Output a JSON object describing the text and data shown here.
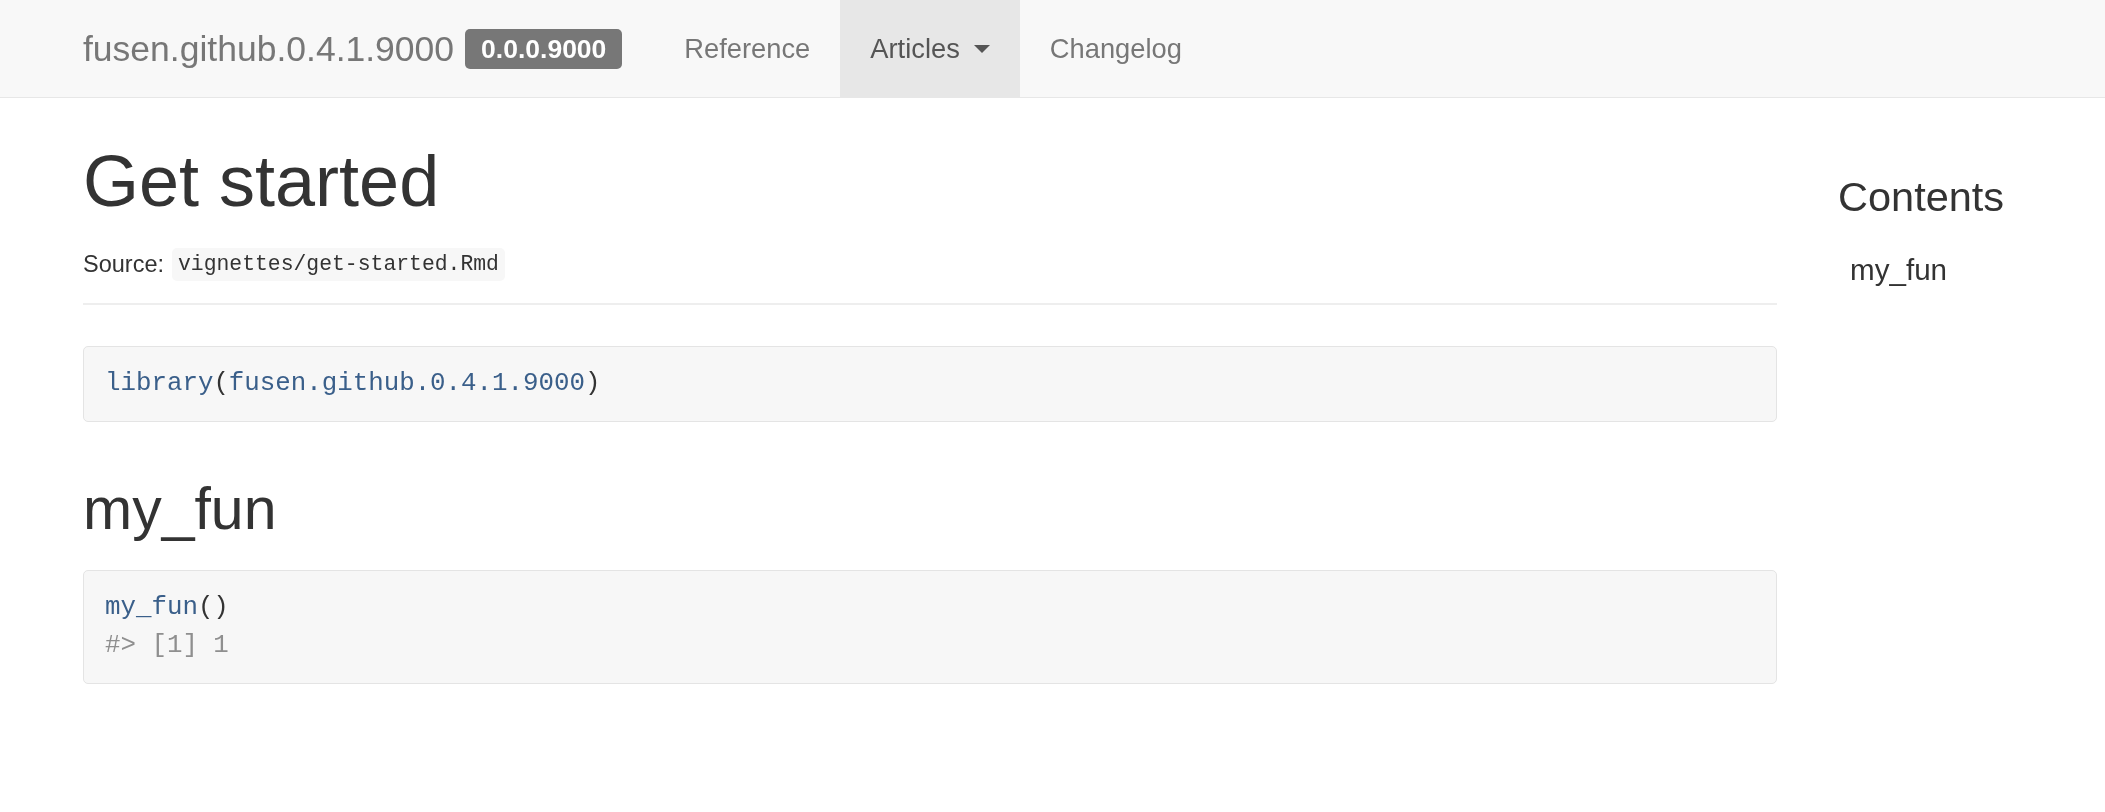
{
  "navbar": {
    "brand": "fusen.github.0.4.1.9000",
    "version_badge": "0.0.0.9000",
    "items": [
      {
        "label": "Reference",
        "kind": "link",
        "selected": false
      },
      {
        "label": "Articles",
        "kind": "dropdown",
        "selected": true
      },
      {
        "label": "Changelog",
        "kind": "link",
        "selected": false
      }
    ]
  },
  "article": {
    "title": "Get started",
    "source_label": "Source:",
    "source_path": "vignettes/get-started.Rmd",
    "blocks": [
      {
        "kind": "code",
        "lines": [
          [
            {
              "kind": "symbol",
              "text": "library"
            },
            {
              "kind": "plain",
              "text": "("
            },
            {
              "kind": "symbol",
              "text": "fusen.github.0.4.1.9000"
            },
            {
              "kind": "plain",
              "text": ")"
            }
          ]
        ]
      },
      {
        "kind": "heading",
        "text": "my_fun"
      },
      {
        "kind": "code",
        "lines": [
          [
            {
              "kind": "symbol",
              "text": "my_fun"
            },
            {
              "kind": "plain",
              "text": "()"
            }
          ],
          [
            {
              "kind": "output",
              "text": "#> [1] 1"
            }
          ]
        ]
      }
    ]
  },
  "toc": {
    "title": "Contents",
    "items": [
      {
        "label": "my_fun"
      }
    ]
  }
}
